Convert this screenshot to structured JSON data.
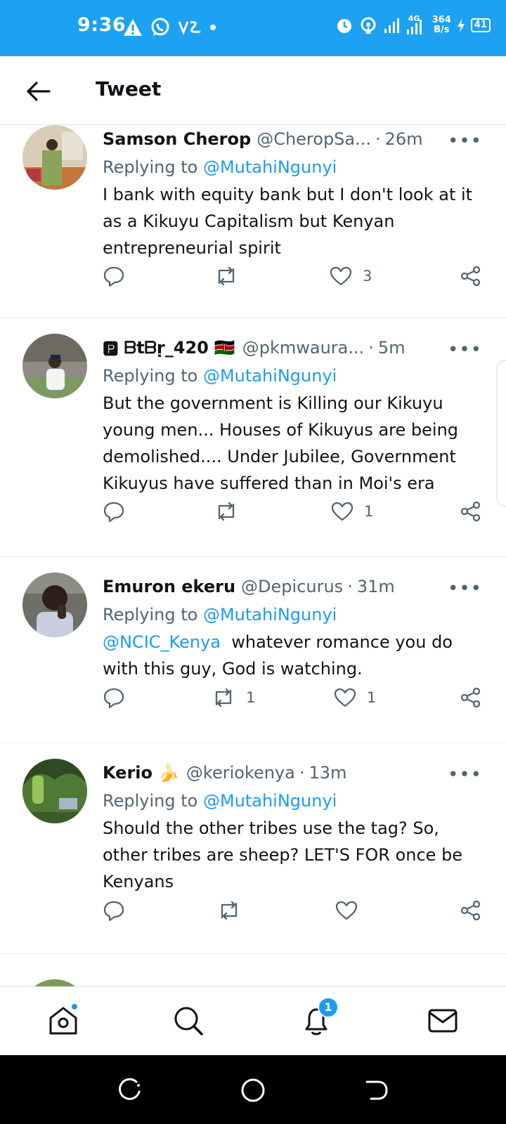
{
  "status_bar": {
    "time": "9:36",
    "network": "4G",
    "speed_value": "364",
    "speed_unit": "B/s",
    "battery": "41",
    "color": "#1da1f2"
  },
  "header": {
    "title": "Tweet"
  },
  "tweets": [
    {
      "name": "Samson Cherop",
      "handle": "@CheropSa...",
      "time": "26m",
      "reply_prefix": "Replying to ",
      "reply_to": "@MutahiNgunyi",
      "mention": "",
      "text": "I bank with equity bank but I don't look at it as a Kikuyu Capitalism but Kenyan entrepreneurial spirit",
      "retweets": "",
      "likes": "3"
    },
    {
      "name": "🅿 ᗷtᗷṛ_420",
      "flag": "🇰🇪",
      "handle": "@pkmwaura...",
      "time": "5m",
      "reply_prefix": "Replying to ",
      "reply_to": "@MutahiNgunyi",
      "mention": "",
      "text": "But the government is Killing our Kikuyu young men... Houses of Kikuyus are being demolished.... Under Jubilee, Government Kikuyus have suffered than in Moi's era",
      "retweets": "",
      "likes": "1"
    },
    {
      "name": "Emuron ekeru",
      "handle": "@Depicurus",
      "time": "31m",
      "reply_prefix": "Replying to ",
      "reply_to": "@MutahiNgunyi",
      "mention": "@NCIC_Kenya",
      "text": "  whatever romance you do with this guy, God is watching.",
      "retweets": "1",
      "likes": "1"
    },
    {
      "name": "Kerio",
      "emoji": "🍌",
      "handle": "@keriokenya",
      "time": "13m",
      "reply_prefix": "Replying to ",
      "reply_to": "@MutahiNgunyi",
      "mention": "",
      "text": "Should the other tribes use the tag? So, other tribes are sheep?  LET'S FOR once be Kenyans",
      "retweets": "",
      "likes": ""
    }
  ],
  "bottom_nav": {
    "notifications_badge": "1",
    "icons": [
      "home-icon",
      "search-icon",
      "notifications-icon",
      "messages-icon"
    ]
  },
  "colors": {
    "accent": "#1d9bf0",
    "muted": "#536471",
    "text": "#0f1419"
  },
  "dot": "·",
  "more": "•••"
}
